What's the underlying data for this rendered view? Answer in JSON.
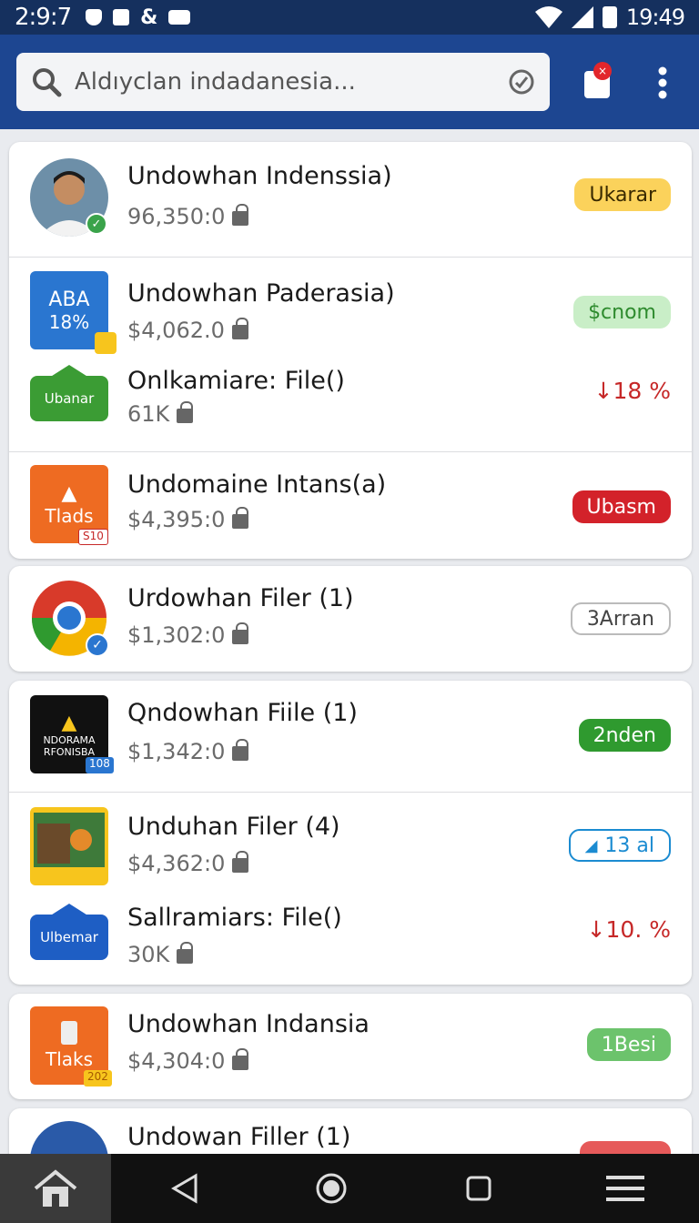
{
  "status_bar": {
    "time": "2:9:7",
    "clock": "19:49"
  },
  "search": {
    "placeholder": "Aldıyclan indadanesia..."
  },
  "notification": {
    "badge_icon": "close-icon"
  },
  "items": [
    {
      "title": "Undowhan Indenssia)",
      "sub": "96,350:0",
      "badge": "Ukarar",
      "badge_color": "#fbd25b",
      "badge_text_color": "#3a2a00"
    },
    {
      "title": "Undowhan Paderasia)",
      "sub": "$4,062.0",
      "badge": "$cnom",
      "badge_color": "#c9eec7",
      "badge_text_color": "#2e8b2e",
      "thumb_text": "ABA",
      "thumb_text2": "18%"
    },
    {
      "title": "Onlkamiare: File()",
      "sub": "61K",
      "change": "↓18 %",
      "thumb_text": "Ubanar"
    },
    {
      "title": "Undomaine Intans(a)",
      "sub": "$4,395:0",
      "badge": "Ubasm",
      "badge_color": "#d3222a",
      "badge_text_color": "#ffffff",
      "thumb_text": "Tlads",
      "thumb_tag": "S10"
    },
    {
      "title": "Urdowhan Filer (1)",
      "sub": "$1,302:0",
      "badge": "3Arran",
      "badge_color": "#ffffff",
      "badge_text_color": "#444444"
    },
    {
      "title": "Qndowhan Fiile (1)",
      "sub": "$1,342:0",
      "badge": "2nden",
      "badge_color": "#2f9a2f",
      "badge_text_color": "#ffffff",
      "thumb_text": "NDORAMA",
      "thumb_text2": "RFONISBA",
      "thumb_tag": "108"
    },
    {
      "title": "Unduhan Filer (4)",
      "sub": "$4,362:0",
      "badge": "13 al",
      "badge_color": "#ffffff",
      "badge_text_color": "#1b8bd1"
    },
    {
      "title": "Sallramiars: File()",
      "sub": "30K",
      "change": "↓10. %",
      "thumb_text": "Ulbemar"
    },
    {
      "title": "Undowhan Indansia",
      "sub": "$4,304:0",
      "badge": "1Besi",
      "badge_color": "#6cc36c",
      "badge_text_color": "#ffffff",
      "thumb_text": "Tlaks",
      "thumb_tag": "202"
    },
    {
      "title": "Undowan Filler (1)",
      "sub": "",
      "badge": "",
      "badge_color": "#e65a5a"
    }
  ],
  "nav": {
    "icons": [
      "home-icon",
      "back-icon",
      "home-circle-icon",
      "recents-icon",
      "menu-icon"
    ]
  }
}
